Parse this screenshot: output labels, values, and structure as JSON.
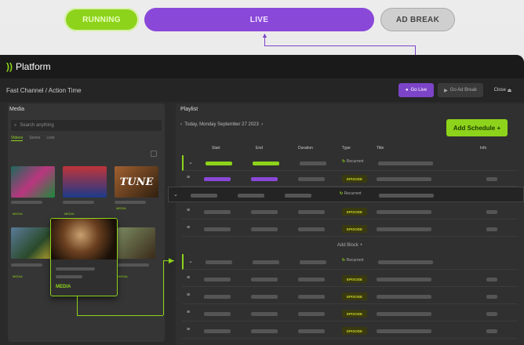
{
  "states": {
    "running": "RUNNING",
    "live": "LIVE",
    "ad_break": "AD BREAK"
  },
  "app": {
    "logo": "))",
    "name": "Platform"
  },
  "subbar": {
    "title": "Fast Channel / Action Time",
    "go_live": "Go Live",
    "go_live_ad": "Go Ad Break",
    "close": "Close"
  },
  "media": {
    "title": "Media",
    "search_placeholder": "Search anything",
    "filters": [
      "Videos",
      "Series",
      "Lists"
    ],
    "tags": [
      "MEDIA",
      "MEDIA",
      "MEDIA",
      "MEDIA",
      "MEDIA",
      "MEDIA"
    ],
    "thumb_text": "TUNE",
    "popup_tag": "MEDIA"
  },
  "playlist": {
    "title": "Playlist",
    "date": "Today, Monday September 27 2023",
    "add_schedule": "Add Schedule",
    "columns": [
      "Start",
      "End",
      "Duration",
      "Type",
      "Title",
      "Info"
    ],
    "recurrent": "Recurrent",
    "episode": "EPISODE",
    "add_block": "Add Block"
  },
  "colors": {
    "green": "#8ed31b",
    "purple": "#8a48d8"
  }
}
